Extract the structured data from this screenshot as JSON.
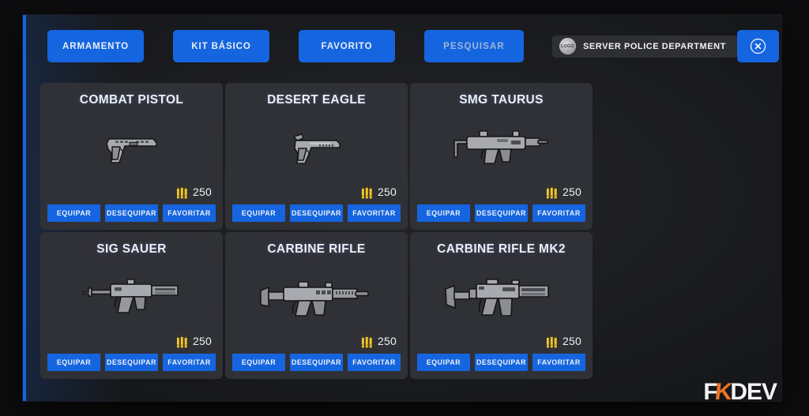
{
  "window": {
    "accent_color": "#1565e0",
    "panel_bg": "#232428",
    "card_bg": "#303136"
  },
  "toolbar": {
    "tabs": [
      {
        "label": "ARMAMENTO",
        "name": "tab-armamento"
      },
      {
        "label": "KIT BÁSICO",
        "name": "tab-kit-basico"
      },
      {
        "label": "FAVORITO",
        "name": "tab-favorito"
      }
    ],
    "search_label": "PESQUISAR",
    "server_badge": {
      "logo_text": "LOGO",
      "name": "SERVER POLICE DEPARTMENT"
    },
    "close_label": "×"
  },
  "cards": [
    {
      "title": "COMBAT PISTOL",
      "art": "pistol",
      "ammo": "250",
      "actions": [
        "EQUIPAR",
        "DESEQUIPAR",
        "FAVORITAR"
      ]
    },
    {
      "title": "DESERT EAGLE",
      "art": "deagle",
      "ammo": "250",
      "actions": [
        "EQUIPAR",
        "DESEQUIPAR",
        "FAVORITAR"
      ]
    },
    {
      "title": "SMG TAURUS",
      "art": "smg",
      "ammo": "250",
      "actions": [
        "EQUIPAR",
        "DESEQUIPAR",
        "FAVORITAR"
      ]
    },
    {
      "title": "SIG SAUER",
      "art": "sig",
      "ammo": "250",
      "actions": [
        "EQUIPAR",
        "DESEQUIPAR",
        "FAVORITAR"
      ]
    },
    {
      "title": "CARBINE RIFLE",
      "art": "carbine",
      "ammo": "250",
      "actions": [
        "EQUIPAR",
        "DESEQUIPAR",
        "FAVORITAR"
      ]
    },
    {
      "title": "CARBINE RIFLE MK2",
      "art": "carbine_mk2",
      "ammo": "250",
      "actions": [
        "EQUIPAR",
        "DESEQUIPAR",
        "FAVORITAR"
      ]
    }
  ],
  "watermark": {
    "part1": "F",
    "part2": "K",
    "part3": "DEV",
    "accent": "#ee7424"
  }
}
